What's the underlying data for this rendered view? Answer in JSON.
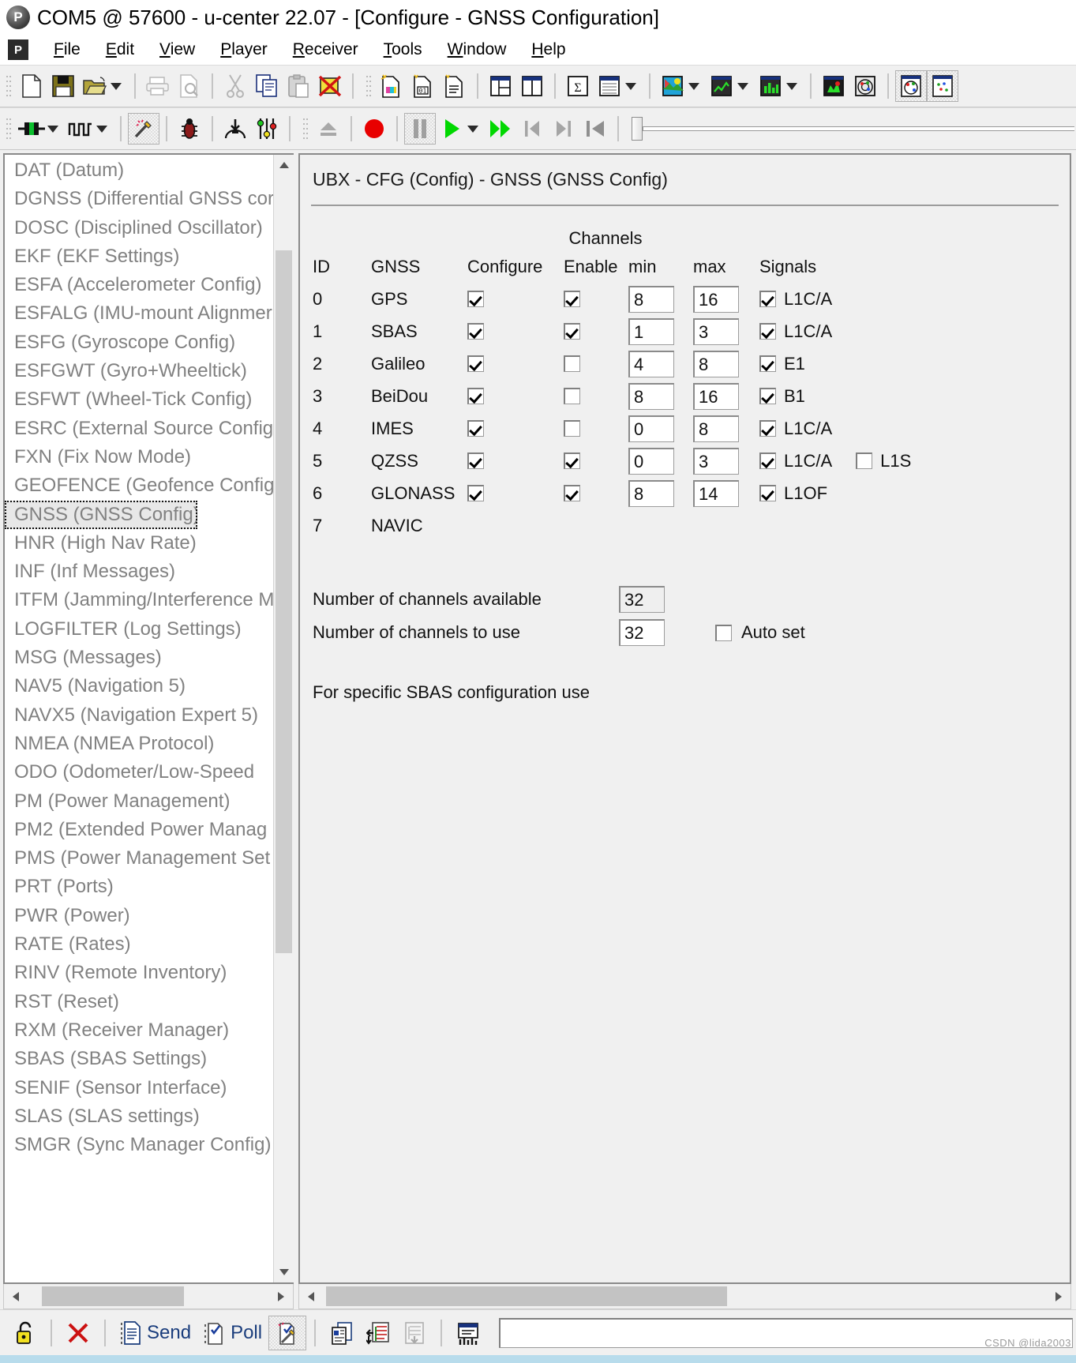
{
  "window": {
    "title": "COM5 @ 57600 - u-center 22.07 - [Configure - GNSS Configuration]",
    "logo_letter": "P"
  },
  "menubar": {
    "logo_letter": "P",
    "items": [
      {
        "first": "F",
        "rest": "ile"
      },
      {
        "first": "E",
        "rest": "dit"
      },
      {
        "first": "V",
        "rest": "iew"
      },
      {
        "first": "P",
        "rest": "layer"
      },
      {
        "first": "R",
        "rest": "eceiver"
      },
      {
        "first": "T",
        "rest": "ools"
      },
      {
        "first": "W",
        "rest": "indow"
      },
      {
        "first": "H",
        "rest": "elp"
      }
    ]
  },
  "toolbar_main": {
    "icons": [
      "new-document-icon",
      "save-icon",
      "open-folder-icon",
      "open-dropdown-arrow",
      "print-icon",
      "print-preview-icon",
      "cut-icon",
      "copy-icon",
      "paste-icon",
      "delete-icon",
      "new-config-color-icon",
      "new-binary-icon",
      "new-text-icon",
      "split-view-horizontal-icon",
      "split-view-vertical-icon",
      "statistics-icon",
      "table-view-icon",
      "table-dropdown-arrow",
      "map-view-icon",
      "map-dropdown-arrow",
      "chart-view-icon",
      "chart-dropdown-arrow",
      "histogram-view-icon",
      "histogram-dropdown-arrow",
      "satellite-signal-icon",
      "sky-view-icon",
      "sky-view-toggle-icon",
      "deviation-map-icon"
    ]
  },
  "toolbar_player": {
    "icons": [
      "connection-icon",
      "connection-dropdown-arrow",
      "baudrate-icon",
      "baudrate-dropdown-arrow",
      "autoconfig-wand-icon",
      "debug-bug-icon",
      "download-icon",
      "settings-sliders-icon",
      "eject-icon",
      "record-icon",
      "pause-icon",
      "play-icon",
      "play-dropdown-arrow",
      "fast-forward-icon",
      "step-back-icon",
      "step-forward-icon",
      "rewind-to-start-icon"
    ]
  },
  "sidebar": {
    "items": [
      {
        "label": "DAT (Datum)",
        "selected": false
      },
      {
        "label": "DGNSS (Differential GNSS cor",
        "selected": false
      },
      {
        "label": "DOSC (Disciplined Oscillator)",
        "selected": false
      },
      {
        "label": "EKF (EKF Settings)",
        "selected": false
      },
      {
        "label": "ESFA (Accelerometer Config)",
        "selected": false
      },
      {
        "label": "ESFALG (IMU-mount Alignmer",
        "selected": false
      },
      {
        "label": "ESFG (Gyroscope Config)",
        "selected": false
      },
      {
        "label": "ESFGWT (Gyro+Wheeltick)",
        "selected": false
      },
      {
        "label": "ESFWT (Wheel-Tick Config)",
        "selected": false
      },
      {
        "label": "ESRC (External Source Config)",
        "selected": false
      },
      {
        "label": "FXN (Fix Now Mode)",
        "selected": false
      },
      {
        "label": "GEOFENCE (Geofence Config)",
        "selected": false
      },
      {
        "label": "GNSS (GNSS Config)",
        "selected": true
      },
      {
        "label": "HNR (High Nav Rate)",
        "selected": false
      },
      {
        "label": "INF (Inf Messages)",
        "selected": false
      },
      {
        "label": "ITFM (Jamming/Interference M",
        "selected": false
      },
      {
        "label": "LOGFILTER (Log Settings)",
        "selected": false
      },
      {
        "label": "MSG (Messages)",
        "selected": false
      },
      {
        "label": "NAV5 (Navigation 5)",
        "selected": false
      },
      {
        "label": "NAVX5 (Navigation Expert 5)",
        "selected": false
      },
      {
        "label": "NMEA (NMEA Protocol)",
        "selected": false
      },
      {
        "label": "ODO (Odometer/Low-Speed ",
        "selected": false
      },
      {
        "label": "PM (Power Management)",
        "selected": false
      },
      {
        "label": "PM2 (Extended Power Manag",
        "selected": false
      },
      {
        "label": "PMS (Power Management Set",
        "selected": false
      },
      {
        "label": "PRT (Ports)",
        "selected": false
      },
      {
        "label": "PWR (Power)",
        "selected": false
      },
      {
        "label": "RATE (Rates)",
        "selected": false
      },
      {
        "label": "RINV (Remote Inventory)",
        "selected": false
      },
      {
        "label": "RST (Reset)",
        "selected": false
      },
      {
        "label": "RXM (Receiver Manager)",
        "selected": false
      },
      {
        "label": "SBAS (SBAS Settings)",
        "selected": false
      },
      {
        "label": "SENIF (Sensor Interface)",
        "selected": false
      },
      {
        "label": "SLAS (SLAS settings)",
        "selected": false
      },
      {
        "label": "SMGR (Sync Manager Config)",
        "selected": false
      }
    ]
  },
  "config": {
    "title": "UBX - CFG (Config) - GNSS (GNSS Config)",
    "group_header": "Channels",
    "columns": {
      "id": "ID",
      "gnss": "GNSS",
      "configure": "Configure",
      "enable": "Enable",
      "min": "min",
      "max": "max",
      "signals": "Signals"
    },
    "rows": [
      {
        "id": "0",
        "gnss": "GPS",
        "configure": true,
        "enable": true,
        "min": "8",
        "max": "16",
        "signal1": "L1C/A",
        "signal1_checked": true,
        "signal2": null,
        "signal2_checked": false,
        "has_controls": true
      },
      {
        "id": "1",
        "gnss": "SBAS",
        "configure": true,
        "enable": true,
        "min": "1",
        "max": "3",
        "signal1": "L1C/A",
        "signal1_checked": true,
        "signal2": null,
        "signal2_checked": false,
        "has_controls": true
      },
      {
        "id": "2",
        "gnss": "Galileo",
        "configure": true,
        "enable": false,
        "min": "4",
        "max": "8",
        "signal1": "E1",
        "signal1_checked": true,
        "signal2": null,
        "signal2_checked": false,
        "has_controls": true
      },
      {
        "id": "3",
        "gnss": "BeiDou",
        "configure": true,
        "enable": false,
        "min": "8",
        "max": "16",
        "signal1": "B1",
        "signal1_checked": true,
        "signal2": null,
        "signal2_checked": false,
        "has_controls": true
      },
      {
        "id": "4",
        "gnss": "IMES",
        "configure": true,
        "enable": false,
        "min": "0",
        "max": "8",
        "signal1": "L1C/A",
        "signal1_checked": true,
        "signal2": null,
        "signal2_checked": false,
        "has_controls": true
      },
      {
        "id": "5",
        "gnss": "QZSS",
        "configure": true,
        "enable": true,
        "min": "0",
        "max": "3",
        "signal1": "L1C/A",
        "signal1_checked": true,
        "signal2": "L1S",
        "signal2_checked": false,
        "has_controls": true
      },
      {
        "id": "6",
        "gnss": "GLONASS",
        "configure": true,
        "enable": true,
        "min": "8",
        "max": "14",
        "signal1": "L1OF",
        "signal1_checked": true,
        "signal2": null,
        "signal2_checked": false,
        "has_controls": true
      },
      {
        "id": "7",
        "gnss": "NAVIC",
        "configure": false,
        "enable": false,
        "min": "",
        "max": "",
        "signal1": null,
        "signal1_checked": false,
        "signal2": null,
        "signal2_checked": false,
        "has_controls": false
      }
    ],
    "channels_available_label": "Number of channels available",
    "channels_available_value": "32",
    "channels_use_label": "Number of channels to use",
    "channels_use_value": "32",
    "auto_set_label": "Auto set",
    "auto_set_checked": false,
    "sbas_note": "For specific SBAS configuration use"
  },
  "commandbar": {
    "buttons": [
      {
        "name": "unlock-icon",
        "label": ""
      },
      {
        "name": "clear-icon",
        "label": ""
      },
      {
        "name": "send-icon",
        "label": "Send"
      },
      {
        "name": "poll-icon",
        "label": "Poll"
      },
      {
        "name": "autoconfig-icon",
        "label": ""
      },
      {
        "name": "copy-config-icon",
        "label": ""
      },
      {
        "name": "import-config-icon",
        "label": ""
      },
      {
        "name": "export-config-icon",
        "label": ""
      },
      {
        "name": "write-flash-icon",
        "label": ""
      }
    ],
    "input_value": "",
    "input_placeholder": ""
  },
  "watermark": "CSDN @lida2003"
}
